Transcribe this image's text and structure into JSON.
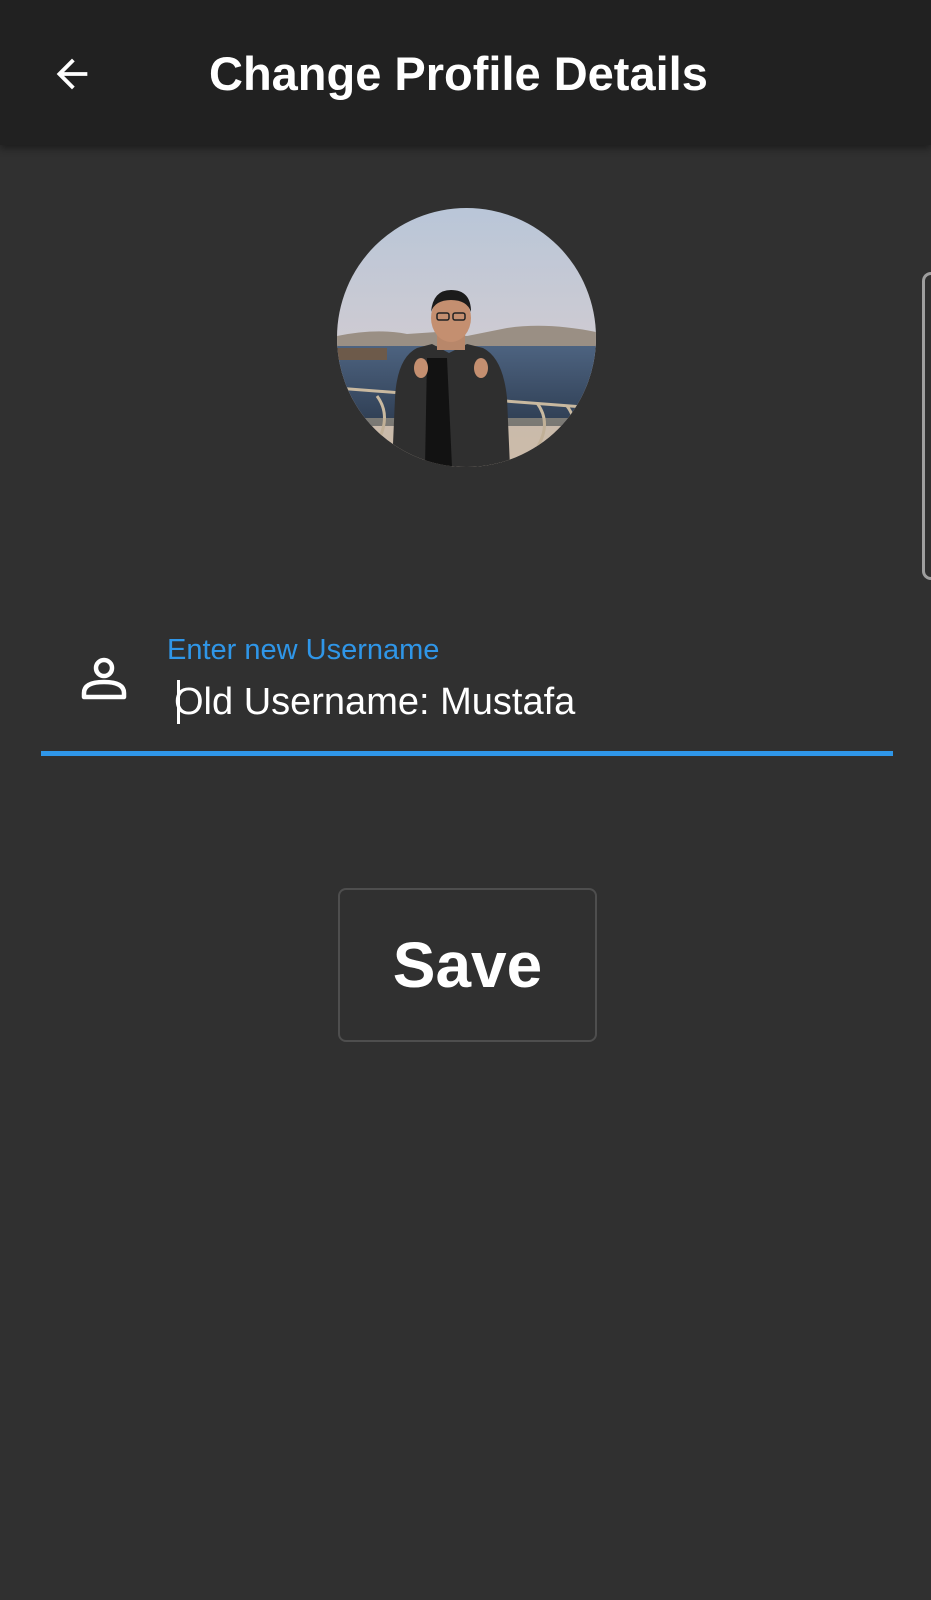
{
  "appbar": {
    "title": "Change Profile Details",
    "back_icon": "arrow-left-icon"
  },
  "profile": {
    "avatar_icon": "profile-photo"
  },
  "username_field": {
    "icon": "person-outline-icon",
    "label": "Enter new Username",
    "placeholder": "Old Username: Mustafa",
    "value": ""
  },
  "actions": {
    "save_label": "Save"
  },
  "colors": {
    "background": "#303030",
    "appbar": "#212121",
    "accent": "#2f96e8",
    "text": "#ffffff"
  }
}
